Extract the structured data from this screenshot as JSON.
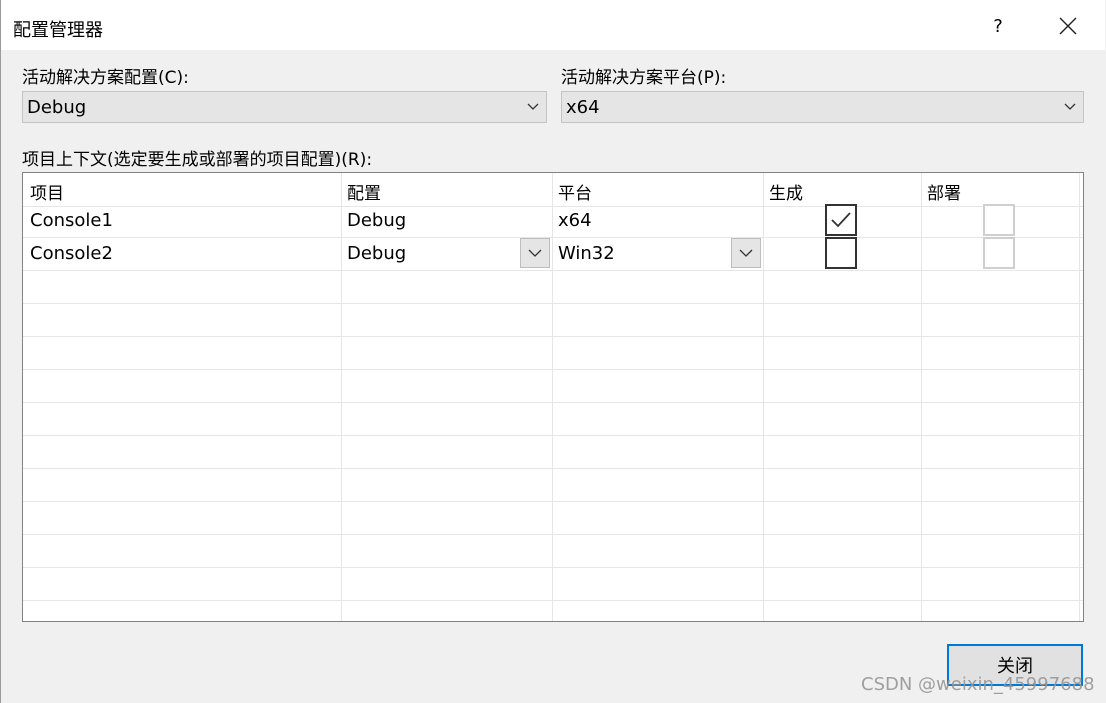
{
  "window": {
    "title": "配置管理器",
    "help": "?"
  },
  "solution_config": {
    "label": "活动解决方案配置(C):",
    "value": "Debug"
  },
  "solution_platform": {
    "label": "活动解决方案平台(P):",
    "value": "x64"
  },
  "contexts": {
    "label": "项目上下文(选定要生成或部署的项目配置)(R):",
    "columns": [
      "项目",
      "配置",
      "平台",
      "生成",
      "部署"
    ],
    "rows": [
      {
        "project": "Console1",
        "config": "Debug",
        "platform": "x64",
        "build": true,
        "deploy": false
      },
      {
        "project": "Console2",
        "config": "Debug",
        "platform": "Win32",
        "build": false,
        "deploy": false
      }
    ]
  },
  "footer": {
    "close_label": "关闭",
    "watermark": "CSDN @weixin_45997688"
  }
}
